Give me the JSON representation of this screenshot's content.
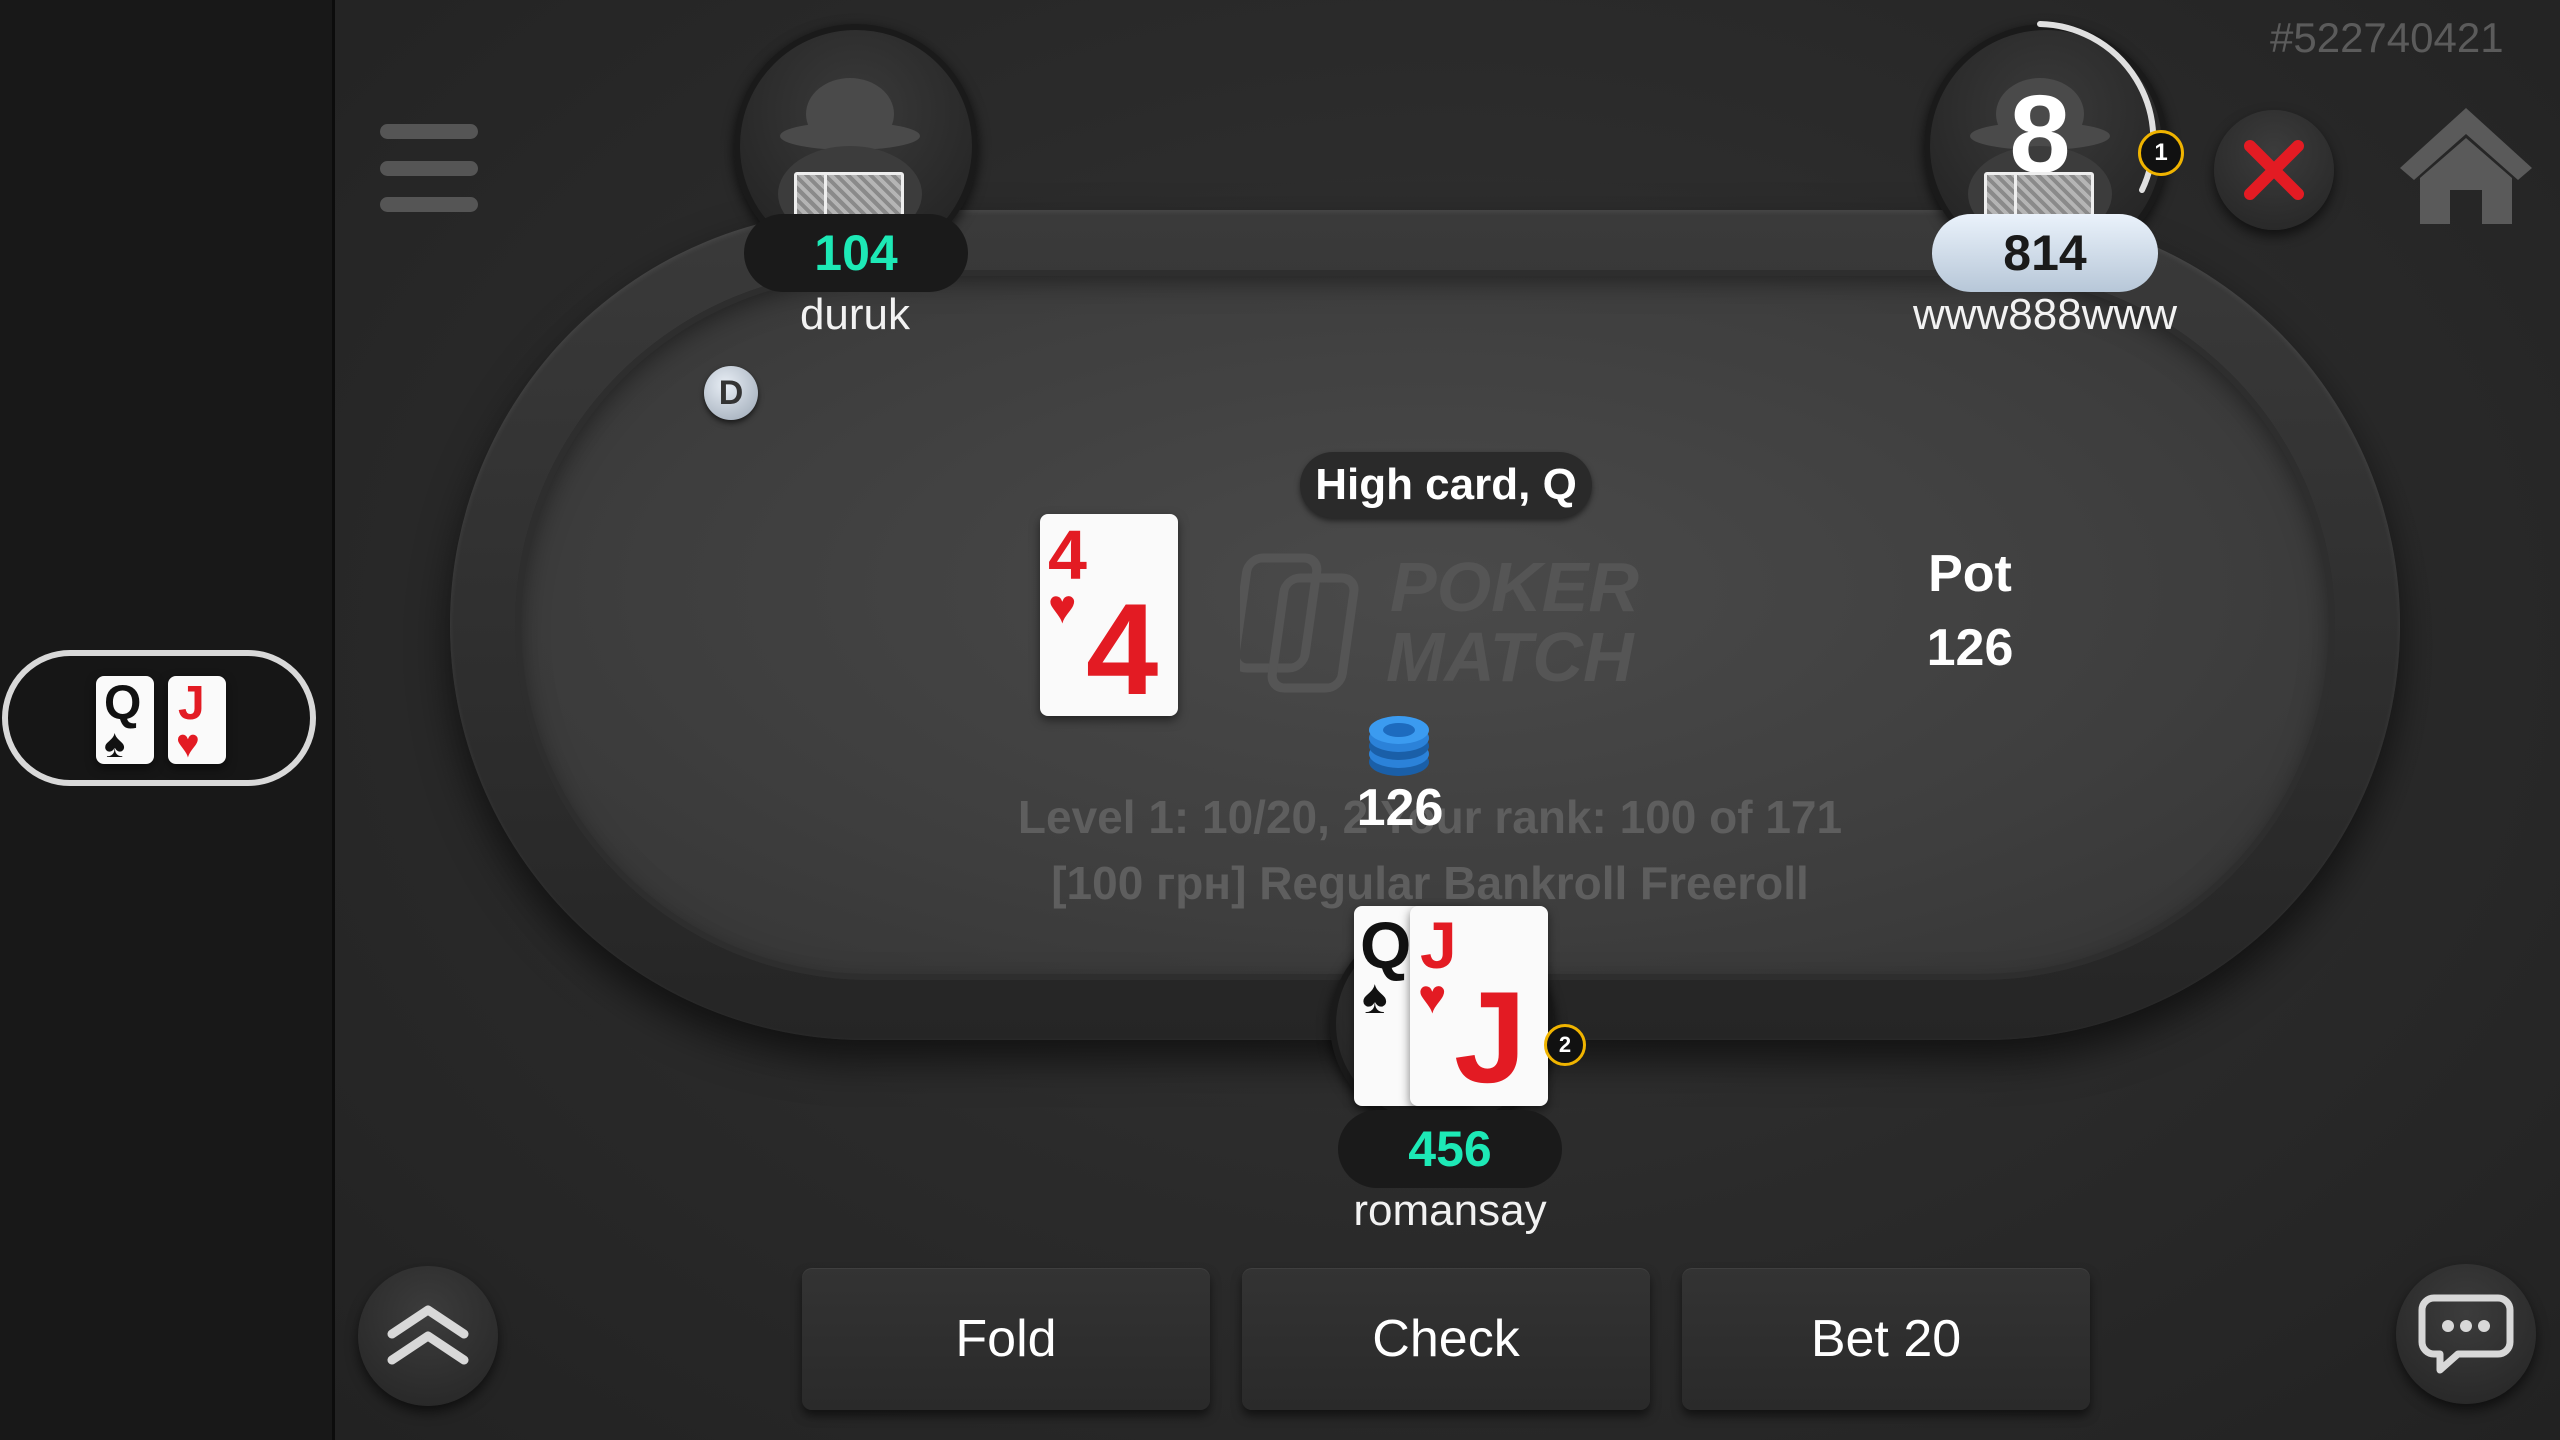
{
  "table_id": "#522740421",
  "hand_strength": "High card, Q",
  "pot": {
    "label": "Pot",
    "amount": "126"
  },
  "center_bet": "126",
  "dealer_button": "D",
  "logo": {
    "line1": "POKER",
    "line2": "MATCH"
  },
  "tournament_info": {
    "line1": "Level 1: 10/20, 2  Your rank: 100 of 171",
    "line2": "[100 грн] Regular Bankroll Freeroll"
  },
  "community_cards": [
    {
      "rank": "4",
      "suit": "♥",
      "color": "#e31b23"
    }
  ],
  "players": {
    "top_left": {
      "name": "duruk",
      "stack": "104",
      "stack_color": "#1de9b6"
    },
    "top_right": {
      "name": "www888www",
      "stack": "814",
      "seat_number": "8",
      "timer_badge": "1"
    },
    "hero": {
      "name": "romansay",
      "stack": "456",
      "stack_color": "#1de9b6",
      "timer_badge": "2",
      "cards": [
        {
          "rank": "Q",
          "suit": "♠"
        },
        {
          "rank": "J",
          "suit": "♥"
        }
      ]
    }
  },
  "mini_hand": [
    {
      "rank": "Q",
      "suit": "♠"
    },
    {
      "rank": "J",
      "suit": "♥"
    }
  ],
  "actions": {
    "fold": "Fold",
    "check": "Check",
    "bet": "Bet 20"
  },
  "icons": {
    "menu": "hamburger-icon",
    "close": "close-icon",
    "home": "home-icon",
    "expand": "chevron-up-double-icon",
    "chat": "chat-bubble-icon"
  },
  "colors": {
    "accent_teal": "#1de9b6",
    "close_red": "#e31b23"
  }
}
